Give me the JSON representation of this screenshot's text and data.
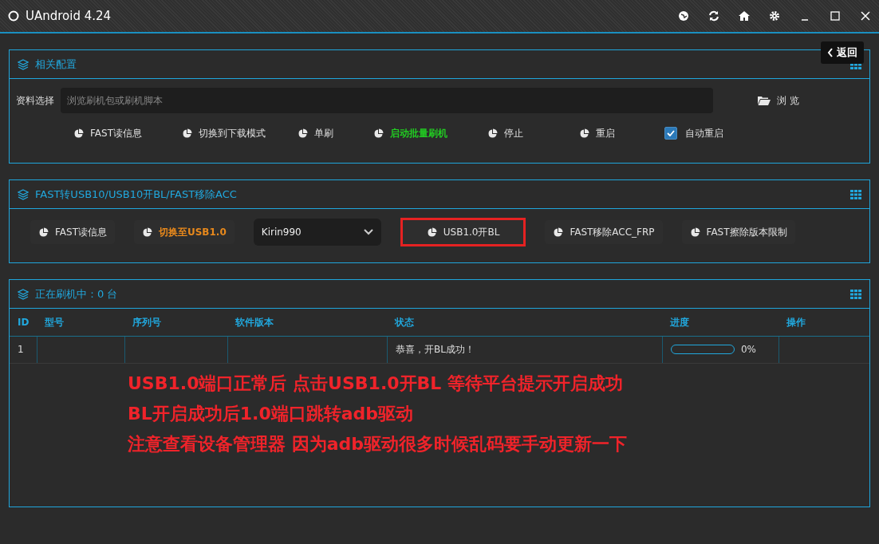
{
  "window": {
    "title": "UAndroid 4.24"
  },
  "back_button": {
    "label": "返回"
  },
  "config_panel": {
    "title": "相关配置",
    "file_label": "资料选择",
    "file_field": {
      "placeholder": "浏览刷机包或刷机脚本"
    },
    "browse_button": "浏 览",
    "actions": [
      {
        "kind": "button",
        "label": "FAST读信息",
        "color": "#e0e0e0"
      },
      {
        "kind": "button",
        "label": "切换到下载模式",
        "color": "#e0e0e0"
      },
      {
        "kind": "button",
        "label": "单刷",
        "color": "#e0e0e0"
      },
      {
        "kind": "button",
        "label": "启动批量刷机",
        "color": "#22cc22"
      },
      {
        "kind": "button",
        "label": "停止",
        "color": "#e0e0e0"
      },
      {
        "kind": "button",
        "label": "重启",
        "color": "#e0e0e0"
      },
      {
        "kind": "checkbox",
        "label": "自动重启",
        "checked": true
      }
    ]
  },
  "usb_panel": {
    "title": "FAST转USB10/USB10开BL/FAST移除ACC",
    "actions": [
      {
        "kind": "button",
        "label": "FAST读信息",
        "color": "#e0e0e0",
        "outlined": false
      },
      {
        "kind": "button",
        "label": "切换至USB1.0",
        "color": "#e8891c",
        "outlined": false
      },
      {
        "kind": "select",
        "value": "Kirin990"
      },
      {
        "kind": "button",
        "label": "USB1.0开BL",
        "color": "#e0e0e0",
        "outlined": true
      },
      {
        "kind": "button",
        "label": "FAST移除ACC_FRP",
        "color": "#e0e0e0",
        "outlined": false
      },
      {
        "kind": "button",
        "label": "FAST擦除版本限制",
        "color": "#e0e0e0",
        "outlined": false
      }
    ]
  },
  "devices_panel": {
    "title": "正在刷机中：0 台",
    "table": {
      "columns": [
        "ID",
        "型号",
        "序列号",
        "软件版本",
        "状态",
        "进度",
        "操作"
      ],
      "rows": [
        {
          "id": "1",
          "model": "",
          "serial": "",
          "version": "",
          "status": "恭喜，开BL成功！",
          "level": 0,
          "percent": "0%",
          "action": ""
        }
      ]
    },
    "notes": [
      "USB1.0端口正常后 点击USB1.0开BL 等待平台提示开启成功",
      "BL开启成功后1.0端口跳转adb驱动",
      "注意查看设备管理器 因为adb驱动很多时候乱码要手动更新一下"
    ]
  }
}
